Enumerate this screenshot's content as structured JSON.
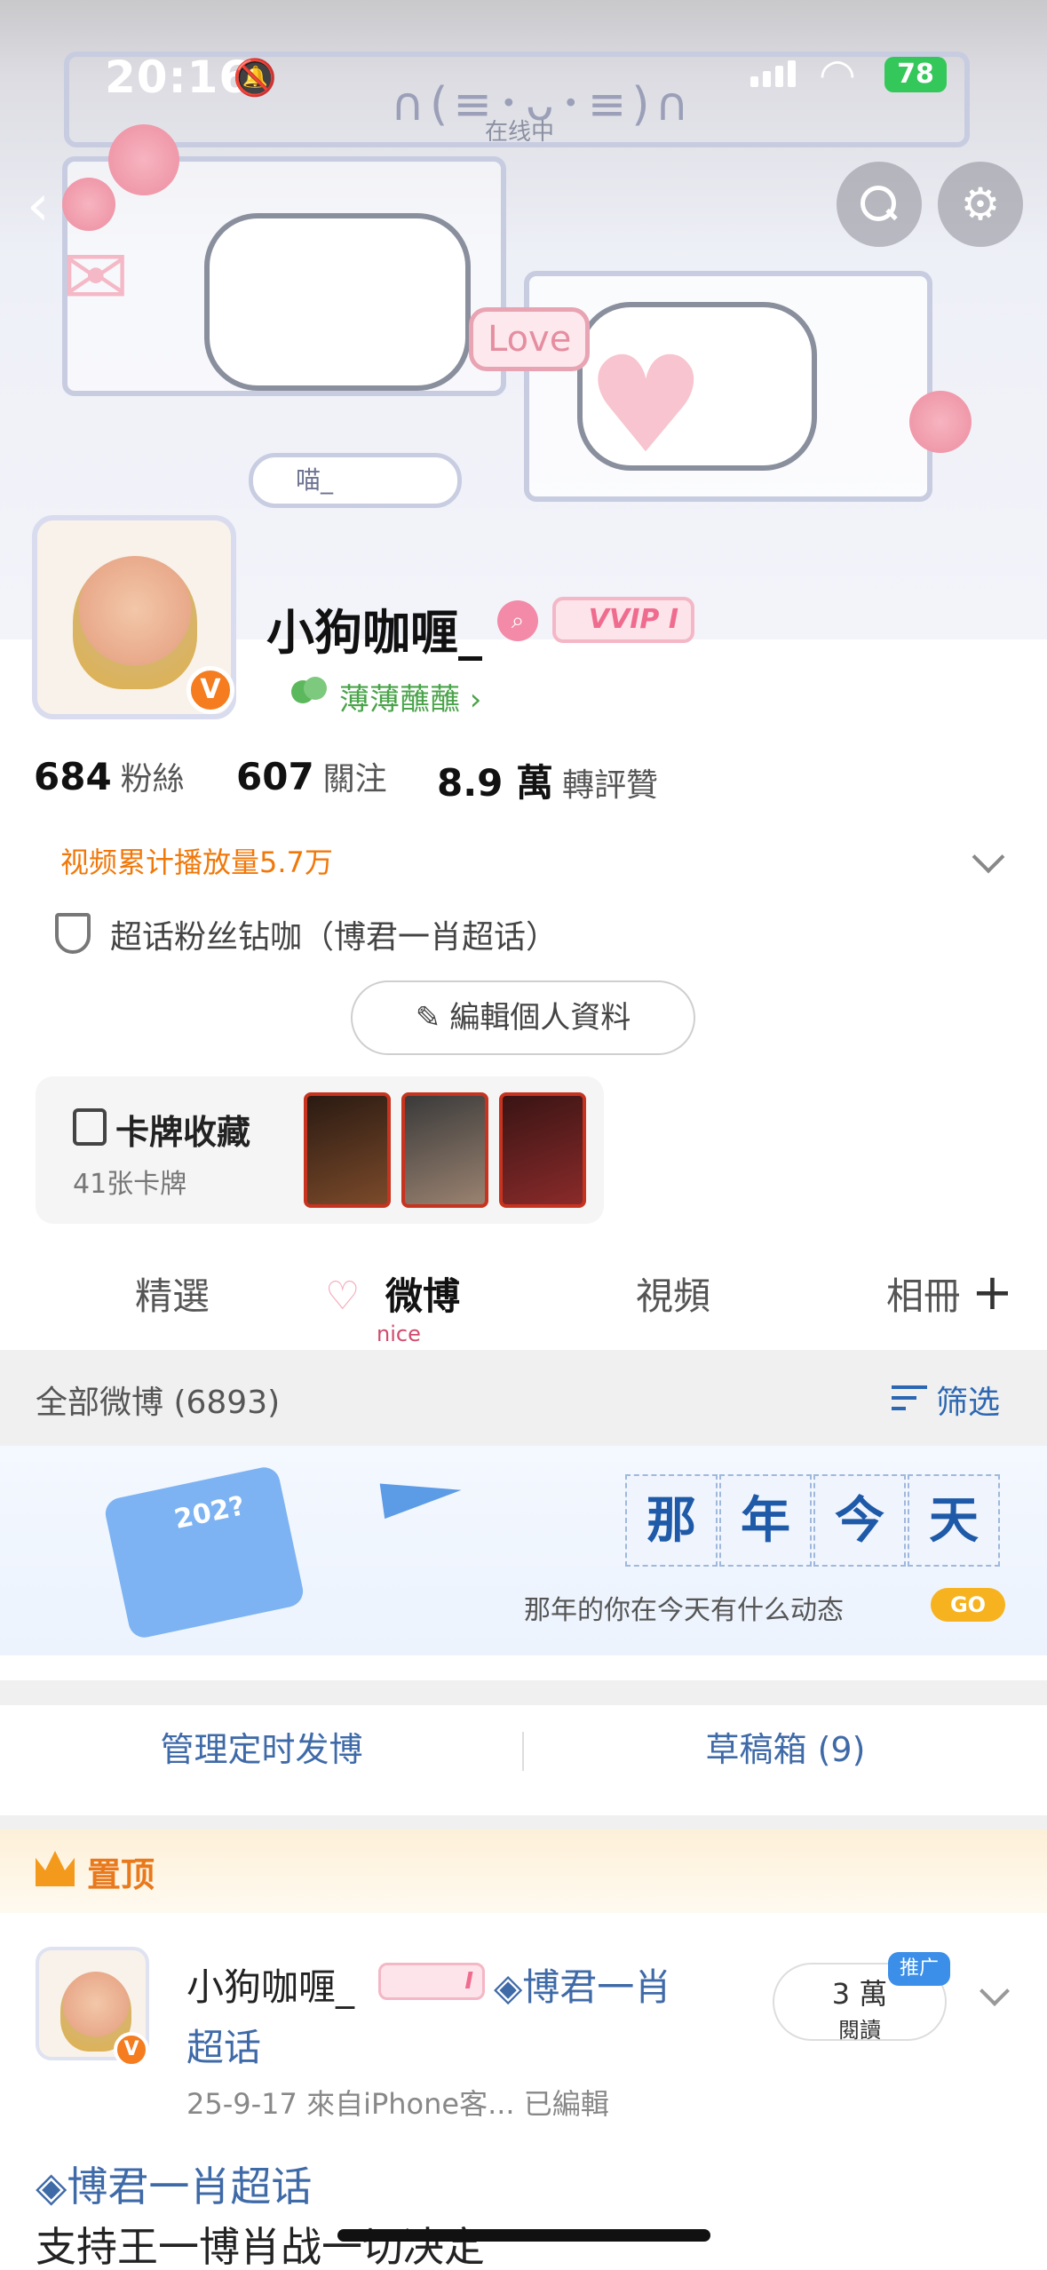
{
  "status_bar": {
    "time": "20:16",
    "battery": "78"
  },
  "banner": {
    "face_text": "∩(≡･ᴗ･≡)∩",
    "status_text": "在线中",
    "love_text": "Love",
    "meow_text": "喵_"
  },
  "profile": {
    "username": "小狗咖喱_",
    "vip_badge": "VVIP I",
    "verified_badge": "V",
    "group_name": "薄薄蘸蘸 ›",
    "stats": [
      {
        "num": "684",
        "label": "粉絲"
      },
      {
        "num": "607",
        "label": "關注"
      },
      {
        "num": "8.9 萬",
        "label": "轉評贊"
      }
    ],
    "play_count": "视频累计播放量5.7万",
    "super_topic": "超话粉丝钻咖（博君一肖超话）",
    "edit_button": "編輯個人資料",
    "card": {
      "title": "卡牌收藏",
      "subtitle": "41张卡牌"
    }
  },
  "tabs": {
    "items": [
      "精選",
      "微博",
      "視頻",
      "相冊"
    ],
    "active": "微博",
    "active_decoration": "nice",
    "plus": "+"
  },
  "filter": {
    "left": "全部微博 (6893)",
    "right": "筛选"
  },
  "promo": {
    "year": "202?",
    "cells": [
      "那",
      "年",
      "今",
      "天"
    ],
    "text": "那年的你在今天有什么动态",
    "go": "GO"
  },
  "actions": {
    "schedule": "管理定时发博",
    "drafts": "草稿箱 (9)"
  },
  "pinned": {
    "label": "置顶"
  },
  "post": {
    "user": "小狗咖喱_",
    "vip": "I",
    "topic_line1": "◈博君一肖",
    "topic_line2": "超话",
    "meta": "25-9-17  來自iPhone客...  已編輯",
    "reads_num": "3 萬",
    "reads_label": "閱讀",
    "promo_tag": "推广",
    "body_topic": "◈博君一肖超话",
    "body_text": "支持王一博肖战一切决定"
  },
  "colors": {
    "accent_orange": "#f0780a",
    "link_blue": "#3f6aa8",
    "battery_green": "#34c759",
    "vip_pink": "#f06c8e"
  }
}
